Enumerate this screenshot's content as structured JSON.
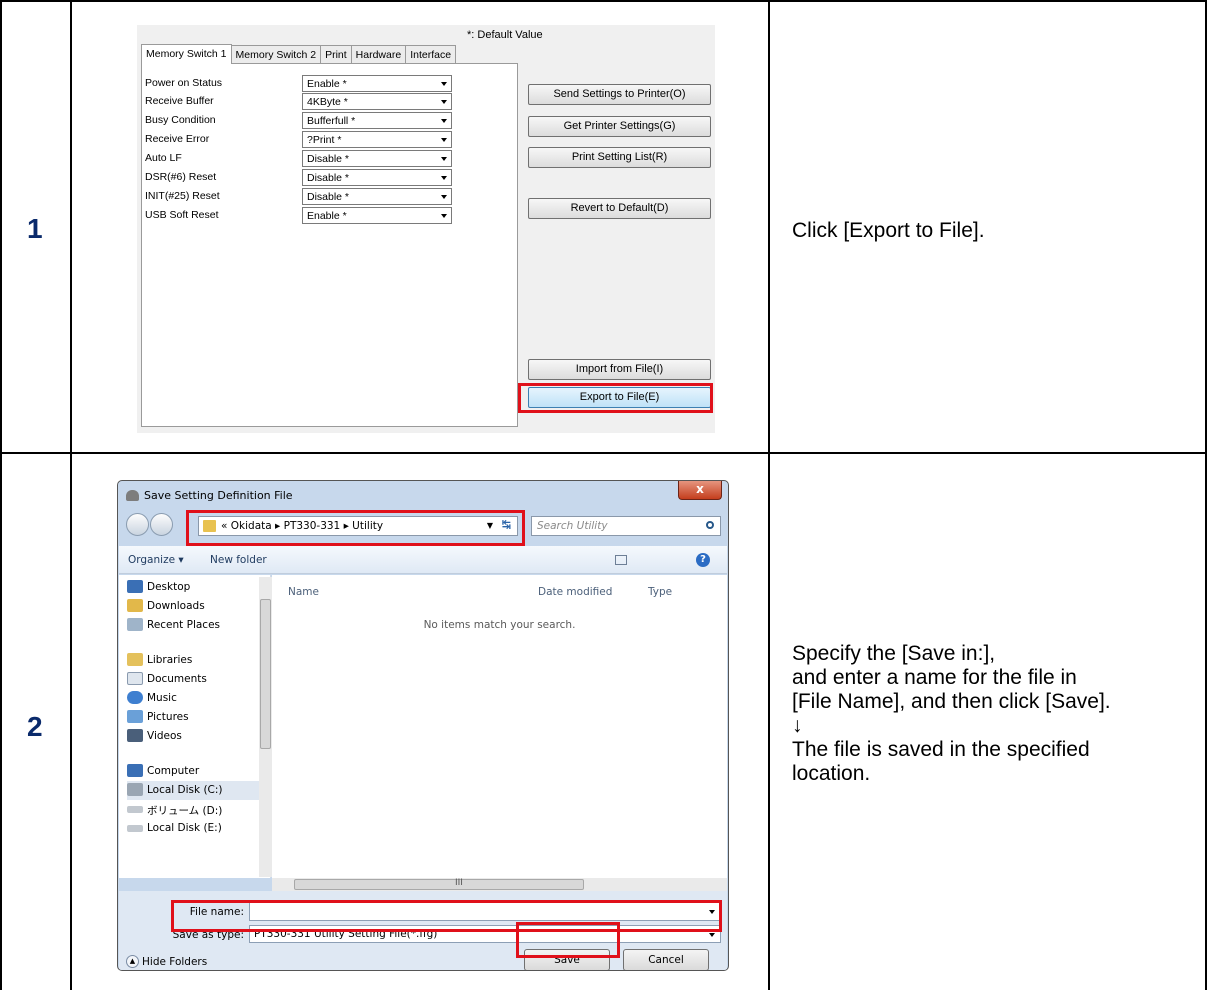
{
  "steps": [
    {
      "number": "1",
      "description": "Click [Export to File]."
    },
    {
      "number": "2",
      "description": "Specify the [Save in:],\nand enter a name for the file in\n[File Name], and then click [Save].\n↓\nThe file is saved in the specified\nlocation."
    }
  ],
  "settings_window": {
    "default_note": "*: Default Value",
    "tabs": [
      "Memory Switch 1",
      "Memory Switch 2",
      "Print",
      "Hardware",
      "Interface"
    ],
    "rows": [
      {
        "label": "Power on Status",
        "value": "Enable *"
      },
      {
        "label": "Receive Buffer",
        "value": "4KByte *"
      },
      {
        "label": "Busy Condition",
        "value": "Bufferfull *"
      },
      {
        "label": "Receive Error",
        "value": "?Print *"
      },
      {
        "label": "Auto LF",
        "value": "Disable *"
      },
      {
        "label": "DSR(#6) Reset",
        "value": "Disable *"
      },
      {
        "label": "INIT(#25) Reset",
        "value": "Disable *"
      },
      {
        "label": "USB Soft Reset",
        "value": "Enable *"
      }
    ],
    "buttons": {
      "send": "Send Settings to Printer(O)",
      "get": "Get Printer Settings(G)",
      "print_list": "Print Setting List(R)",
      "revert": "Revert to Default(D)",
      "import": "Import from File(I)",
      "export": "Export to File(E)"
    }
  },
  "save_dialog": {
    "title": "Save Setting Definition File",
    "close_label": "x",
    "address_path": "« Okidata ▸ PT330-331 ▸ Utility",
    "search_placeholder": "Search Utility",
    "organize": "Organize ▾",
    "new_folder": "New folder",
    "nav_items": [
      {
        "label": "Desktop",
        "icon": "desktop-icon"
      },
      {
        "label": "Downloads",
        "icon": "downloads-icon"
      },
      {
        "label": "Recent Places",
        "icon": "recent-places-icon"
      },
      {
        "label": "Libraries",
        "icon": "libraries-icon"
      },
      {
        "label": "Documents",
        "icon": "documents-icon"
      },
      {
        "label": "Music",
        "icon": "music-icon"
      },
      {
        "label": "Pictures",
        "icon": "pictures-icon"
      },
      {
        "label": "Videos",
        "icon": "videos-icon"
      },
      {
        "label": "Computer",
        "icon": "computer-icon"
      },
      {
        "label": "Local Disk (C:)",
        "icon": "drive-icon"
      },
      {
        "label": "ボリューム (D:)",
        "icon": "drive-icon"
      },
      {
        "label": "Local Disk (E:)",
        "icon": "drive-icon"
      }
    ],
    "columns": [
      "Name",
      "Date modified",
      "Type"
    ],
    "empty_message": "No items match your search.",
    "file_name_label": "File name:",
    "file_name_value": "",
    "save_as_type_label": "Save as type:",
    "save_as_type_value": "PT330-331 Utility Setting File(*.ffg)",
    "save_button": "Save",
    "cancel_button": "Cancel",
    "hide_folders": "Hide Folders",
    "hscroll_mark": "III"
  },
  "colors": {
    "highlight": "#e0101a",
    "step_number": "#0a2a6b"
  }
}
